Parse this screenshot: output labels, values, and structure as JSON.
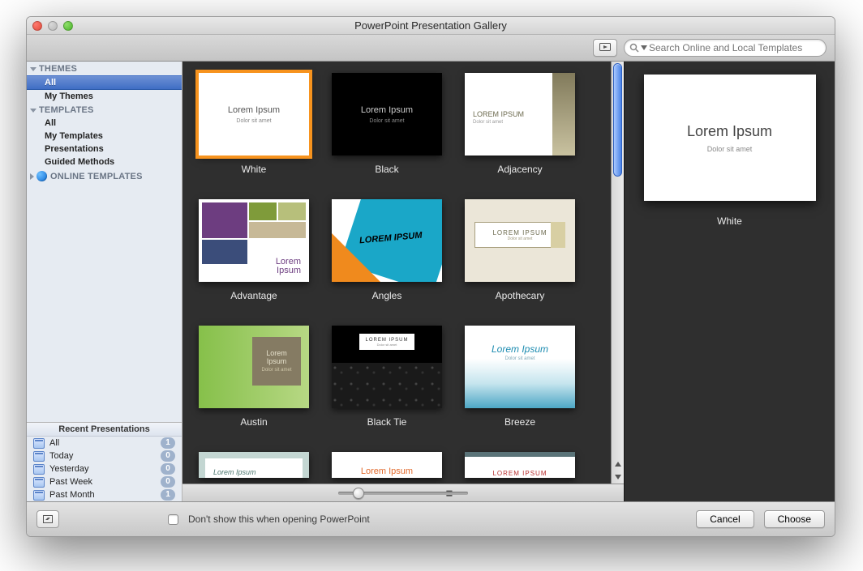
{
  "window": {
    "title": "PowerPoint Presentation Gallery"
  },
  "toolbar": {
    "search_placeholder": "Search Online and Local Templates"
  },
  "sidebar": {
    "sections": {
      "themes_header": "THEMES",
      "templates_header": "TEMPLATES",
      "online_header": "ONLINE TEMPLATES"
    },
    "themes": [
      "All",
      "My Themes"
    ],
    "templates": [
      "All",
      "My Templates",
      "Presentations",
      "Guided Methods"
    ],
    "selected": "All"
  },
  "recent": {
    "header": "Recent Presentations",
    "items": [
      {
        "label": "All",
        "count": "1"
      },
      {
        "label": "Today",
        "count": "0"
      },
      {
        "label": "Yesterday",
        "count": "0"
      },
      {
        "label": "Past Week",
        "count": "0"
      },
      {
        "label": "Past Month",
        "count": "1"
      }
    ]
  },
  "sample": {
    "title": "Lorem Ipsum",
    "subtitle": "Dolor sit amet",
    "title_upper": "LOREM IPSUM"
  },
  "gallery": {
    "items": [
      {
        "name": "White"
      },
      {
        "name": "Black"
      },
      {
        "name": "Adjacency"
      },
      {
        "name": "Advantage"
      },
      {
        "name": "Angles"
      },
      {
        "name": "Apothecary"
      },
      {
        "name": "Austin"
      },
      {
        "name": "Black Tie"
      },
      {
        "name": "Breeze"
      }
    ],
    "selected": "White"
  },
  "preview": {
    "label": "White"
  },
  "bottom": {
    "dont_show_label": "Don't show this when opening PowerPoint",
    "cancel": "Cancel",
    "choose": "Choose"
  }
}
